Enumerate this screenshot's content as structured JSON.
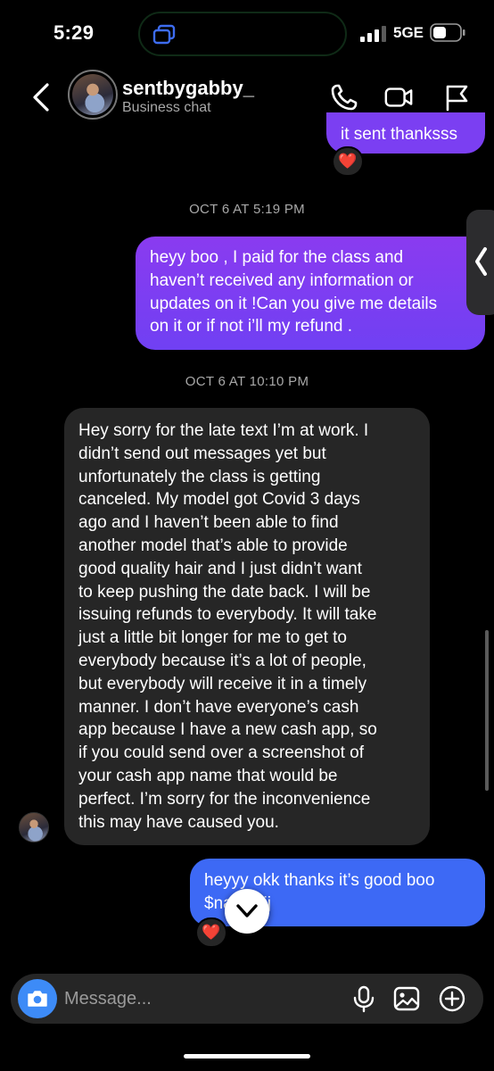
{
  "status_bar": {
    "time": "5:29",
    "network": "5GE",
    "icons": [
      "signal-icon",
      "battery-icon",
      "screen-mirror-icon"
    ]
  },
  "header": {
    "contact_name": "sentbygabby_",
    "subtitle": "Business chat",
    "icons": [
      "back-chevron-icon",
      "phone-icon",
      "video-camera-icon",
      "flag-icon"
    ]
  },
  "messages": [
    {
      "from": "me",
      "text": "it sent thanksss",
      "reaction": "❤️"
    },
    {
      "type": "timestamp",
      "text": "OCT 6 AT 5:19 PM"
    },
    {
      "from": "me",
      "lines": [
        "heyy boo , I paid for the class and",
        "haven’t received any information or",
        "updates on it !Can you give me details",
        "on it or if not i’ll my refund ."
      ]
    },
    {
      "type": "timestamp",
      "text": "OCT 6 AT 10:10 PM"
    },
    {
      "from": "them",
      "lines": [
        "Hey sorry for the late text I’m at work. I",
        "didn’t send out messages yet but",
        "unfortunately the class is getting",
        "canceled. My model got Covid 3 days",
        "ago and I haven’t been able to find",
        "another model that’s able to provide",
        "good quality hair and I just didn’t want",
        "to keep pushing the date back. I will be",
        "issuing refunds to everybody. It will take",
        "just a little bit longer for me to get to",
        "everybody because it’s a lot of people,",
        "but everybody will receive it in a timely",
        "manner. I don’t have everyone’s cash",
        "app because I have a new cash app, so",
        "if you could send over a screenshot of",
        "your cash app name that would be",
        "perfect. I’m sorry for the inconvenience",
        "this may have caused you."
      ]
    },
    {
      "from": "me",
      "lines": [
        "heyyy okk thanks it’s good boo",
        "$nakiaajj"
      ],
      "reaction": "❤️"
    }
  ],
  "composer": {
    "placeholder": "Message...",
    "icons": [
      "camera-icon",
      "microphone-icon",
      "gallery-icon",
      "add-icon"
    ]
  },
  "colors": {
    "background": "#000000",
    "outgoing_bubble": "#7b3ff2",
    "outgoing_latest": "#3d69f5",
    "incoming_bubble": "#262626",
    "camera_button": "#3d8bf7",
    "timestamp_text": "#a8a8a8"
  }
}
